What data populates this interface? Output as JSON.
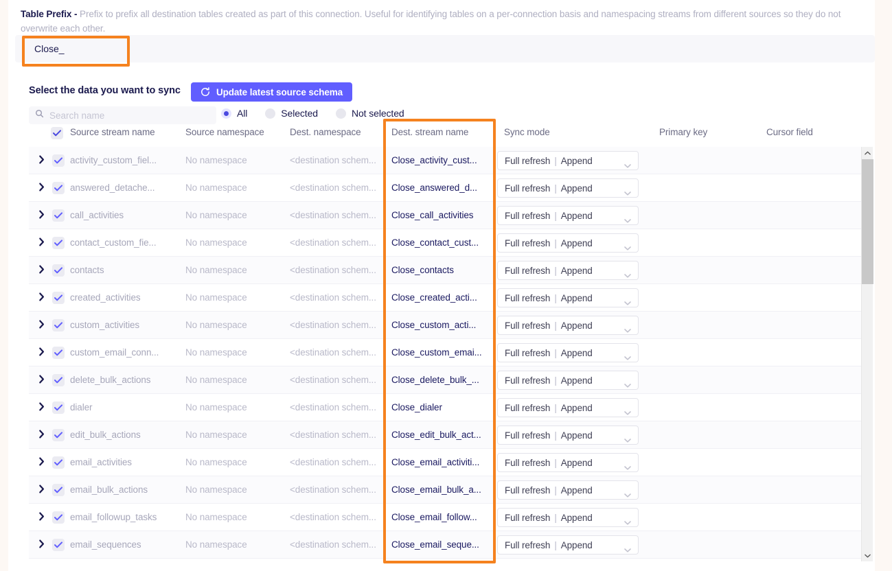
{
  "prefix_section": {
    "label": "Table Prefix -",
    "description": "Prefix to prefix all destination tables created as part of this connection. Useful for identifying tables on a per-connection basis and namespacing streams from different sources so they do not overwrite each other.",
    "input_value": "Close_",
    "input_placeholder": ""
  },
  "sync_section": {
    "title": "Select the data you want to sync",
    "update_button": "Update latest source schema",
    "search_placeholder": "Search name",
    "search_value": "",
    "filters": [
      {
        "label": "All",
        "selected": true
      },
      {
        "label": "Selected",
        "selected": false
      },
      {
        "label": "Not selected",
        "selected": false
      }
    ]
  },
  "table": {
    "headers": {
      "source_stream_name": "Source stream name",
      "source_namespace": "Source namespace",
      "dest_namespace": "Dest. namespace",
      "dest_stream_name": "Dest. stream name",
      "sync_mode": "Sync mode",
      "primary_key": "Primary key",
      "cursor_field": "Cursor field"
    },
    "header_checkbox_checked": true,
    "sync_mode_value": {
      "left": "Full refresh",
      "separator": "|",
      "right": "Append"
    },
    "rows": [
      {
        "source": "activity_custom_fiel...",
        "source_ns": "No namespace",
        "dest_ns": "<destination schem...",
        "dest": "Close_activity_cust...",
        "checked": true
      },
      {
        "source": "answered_detache...",
        "source_ns": "No namespace",
        "dest_ns": "<destination schem...",
        "dest": "Close_answered_d...",
        "checked": true
      },
      {
        "source": "call_activities",
        "source_ns": "No namespace",
        "dest_ns": "<destination schem...",
        "dest": "Close_call_activities",
        "checked": true
      },
      {
        "source": "contact_custom_fie...",
        "source_ns": "No namespace",
        "dest_ns": "<destination schem...",
        "dest": "Close_contact_cust...",
        "checked": true
      },
      {
        "source": "contacts",
        "source_ns": "No namespace",
        "dest_ns": "<destination schem...",
        "dest": "Close_contacts",
        "checked": true
      },
      {
        "source": "created_activities",
        "source_ns": "No namespace",
        "dest_ns": "<destination schem...",
        "dest": "Close_created_acti...",
        "checked": true
      },
      {
        "source": "custom_activities",
        "source_ns": "No namespace",
        "dest_ns": "<destination schem...",
        "dest": "Close_custom_acti...",
        "checked": true
      },
      {
        "source": "custom_email_conn...",
        "source_ns": "No namespace",
        "dest_ns": "<destination schem...",
        "dest": "Close_custom_emai...",
        "checked": true
      },
      {
        "source": "delete_bulk_actions",
        "source_ns": "No namespace",
        "dest_ns": "<destination schem...",
        "dest": "Close_delete_bulk_...",
        "checked": true
      },
      {
        "source": "dialer",
        "source_ns": "No namespace",
        "dest_ns": "<destination schem...",
        "dest": "Close_dialer",
        "checked": true
      },
      {
        "source": "edit_bulk_actions",
        "source_ns": "No namespace",
        "dest_ns": "<destination schem...",
        "dest": "Close_edit_bulk_act...",
        "checked": true
      },
      {
        "source": "email_activities",
        "source_ns": "No namespace",
        "dest_ns": "<destination schem...",
        "dest": "Close_email_activiti...",
        "checked": true
      },
      {
        "source": "email_bulk_actions",
        "source_ns": "No namespace",
        "dest_ns": "<destination schem...",
        "dest": "Close_email_bulk_a...",
        "checked": true
      },
      {
        "source": "email_followup_tasks",
        "source_ns": "No namespace",
        "dest_ns": "<destination schem...",
        "dest": "Close_email_follow...",
        "checked": true
      },
      {
        "source": "email_sequences",
        "source_ns": "No namespace",
        "dest_ns": "<destination schem...",
        "dest": "Close_email_seque...",
        "checked": true
      }
    ]
  },
  "colors": {
    "highlight": "#f5821f",
    "accent": "#615eff",
    "text_dark": "#1a194d",
    "text_muted": "#afafc1"
  }
}
